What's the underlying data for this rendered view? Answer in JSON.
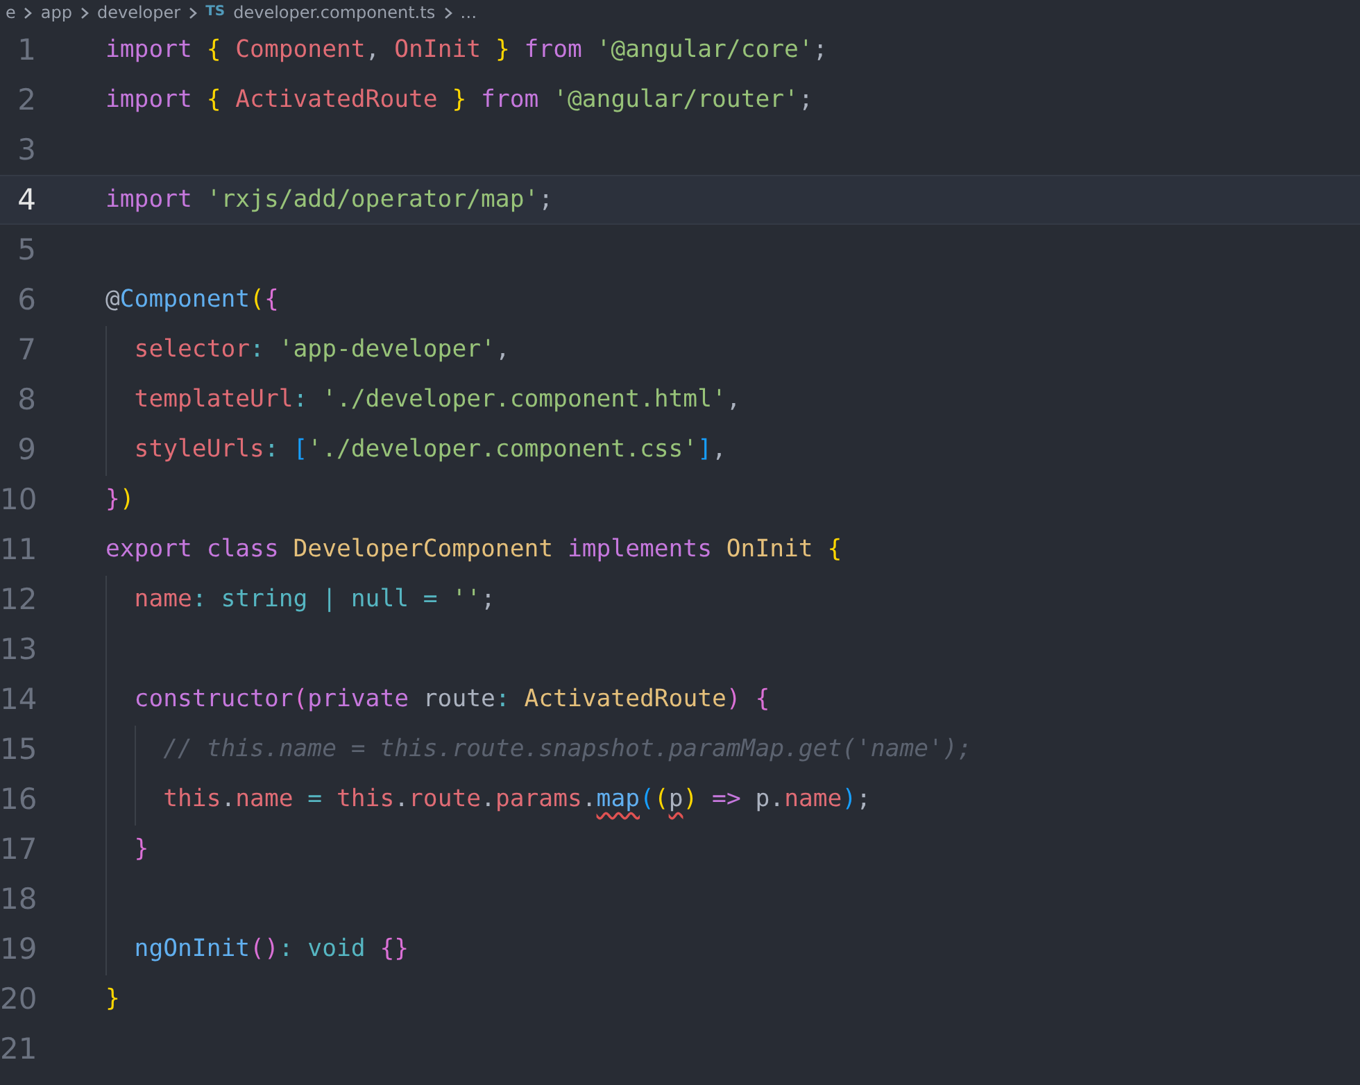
{
  "breadcrumb": {
    "items": [
      {
        "label": "e"
      },
      {
        "label": "app"
      },
      {
        "label": "developer"
      },
      {
        "label": "developer.component.ts",
        "badge": "TS"
      },
      {
        "label": "…"
      }
    ]
  },
  "editor": {
    "lines": [
      {
        "number": "1",
        "current": false,
        "tokens": [
          {
            "kind": "kw",
            "t": "import "
          },
          {
            "kind": "by",
            "t": "{ "
          },
          {
            "kind": "var",
            "t": "Component"
          },
          {
            "kind": "pl",
            "t": ", "
          },
          {
            "kind": "var",
            "t": "OnInit "
          },
          {
            "kind": "by",
            "t": "} "
          },
          {
            "kind": "kw",
            "t": "from "
          },
          {
            "kind": "str",
            "t": "'@angular/core'"
          },
          {
            "kind": "pl",
            "t": ";"
          }
        ]
      },
      {
        "number": "2",
        "current": false,
        "tokens": [
          {
            "kind": "kw",
            "t": "import "
          },
          {
            "kind": "by",
            "t": "{ "
          },
          {
            "kind": "var",
            "t": "ActivatedRoute "
          },
          {
            "kind": "by",
            "t": "} "
          },
          {
            "kind": "kw",
            "t": "from "
          },
          {
            "kind": "str",
            "t": "'@angular/router'"
          },
          {
            "kind": "pl",
            "t": ";"
          }
        ]
      },
      {
        "number": "3",
        "current": false
      },
      {
        "number": "4",
        "current": true,
        "tokens": [
          {
            "kind": "kw",
            "t": "import "
          },
          {
            "kind": "str",
            "t": "'rxjs/add/operator/map'"
          },
          {
            "kind": "pl",
            "t": ";"
          }
        ]
      },
      {
        "number": "5",
        "current": false
      },
      {
        "number": "6",
        "current": false,
        "tokens": [
          {
            "kind": "pl",
            "t": "@"
          },
          {
            "kind": "fn",
            "t": "Component"
          },
          {
            "kind": "by",
            "t": "("
          },
          {
            "kind": "bp",
            "t": "{"
          }
        ]
      },
      {
        "number": "7",
        "current": false,
        "tokens": [
          {
            "kind": "var",
            "t": "  selector"
          },
          {
            "kind": "ty",
            "t": ": "
          },
          {
            "kind": "str",
            "t": "'app-developer'"
          },
          {
            "kind": "pl",
            "t": ","
          }
        ]
      },
      {
        "number": "8",
        "current": false,
        "tokens": [
          {
            "kind": "var",
            "t": "  templateUrl"
          },
          {
            "kind": "ty",
            "t": ": "
          },
          {
            "kind": "str",
            "t": "'./developer.component.html'"
          },
          {
            "kind": "pl",
            "t": ","
          }
        ]
      },
      {
        "number": "9",
        "current": false,
        "tokens": [
          {
            "kind": "var",
            "t": "  styleUrls"
          },
          {
            "kind": "ty",
            "t": ": "
          },
          {
            "kind": "bb",
            "t": "["
          },
          {
            "kind": "str",
            "t": "'./developer.component.css'"
          },
          {
            "kind": "bb",
            "t": "]"
          },
          {
            "kind": "pl",
            "t": ","
          }
        ]
      },
      {
        "number": "10",
        "current": false,
        "tokens": [
          {
            "kind": "bp",
            "t": "}"
          },
          {
            "kind": "by",
            "t": ")"
          }
        ]
      },
      {
        "number": "11",
        "current": false,
        "tokens": [
          {
            "kind": "kw",
            "t": "export class "
          },
          {
            "kind": "cls",
            "t": "DeveloperComponent "
          },
          {
            "kind": "kw",
            "t": "implements "
          },
          {
            "kind": "cls",
            "t": "OnInit "
          },
          {
            "kind": "by",
            "t": "{"
          }
        ]
      },
      {
        "number": "12",
        "current": false,
        "tokens": [
          {
            "kind": "var",
            "t": "  name"
          },
          {
            "kind": "ty",
            "t": ": string | null = "
          },
          {
            "kind": "str",
            "t": "''"
          },
          {
            "kind": "pl",
            "t": ";"
          }
        ]
      },
      {
        "number": "13",
        "current": false
      },
      {
        "number": "14",
        "current": false,
        "tokens": [
          {
            "kind": "kw",
            "t": "  constructor"
          },
          {
            "kind": "bp",
            "t": "("
          },
          {
            "kind": "kw",
            "t": "private "
          },
          {
            "kind": "pl",
            "t": "route"
          },
          {
            "kind": "ty",
            "t": ": "
          },
          {
            "kind": "cls",
            "t": "ActivatedRoute"
          },
          {
            "kind": "bp",
            "t": ") {"
          }
        ]
      },
      {
        "number": "15",
        "current": false,
        "tokens": [
          {
            "kind": "cm",
            "t": "    // this.name = this.route.snapshot.paramMap.get('name');"
          }
        ]
      },
      {
        "number": "16",
        "current": false,
        "tokens": [
          {
            "kind": "var",
            "t": "    this"
          },
          {
            "kind": "pl",
            "t": "."
          },
          {
            "kind": "var",
            "t": "name "
          },
          {
            "kind": "ty",
            "t": "= "
          },
          {
            "kind": "var",
            "t": "this"
          },
          {
            "kind": "pl",
            "t": "."
          },
          {
            "kind": "var",
            "t": "route"
          },
          {
            "kind": "pl",
            "t": "."
          },
          {
            "kind": "var",
            "t": "params"
          },
          {
            "kind": "pl",
            "t": "."
          },
          {
            "kind": "fn",
            "t": "map",
            "error": true
          },
          {
            "kind": "bb",
            "t": "("
          },
          {
            "kind": "by",
            "t": "("
          },
          {
            "kind": "pl",
            "t": "p",
            "error": true
          },
          {
            "kind": "by",
            "t": ") "
          },
          {
            "kind": "kw",
            "t": "=> "
          },
          {
            "kind": "pl",
            "t": "p."
          },
          {
            "kind": "var",
            "t": "name"
          },
          {
            "kind": "bb",
            "t": ")"
          },
          {
            "kind": "pl",
            "t": ";"
          }
        ]
      },
      {
        "number": "17",
        "current": false,
        "tokens": [
          {
            "kind": "bp",
            "t": "  }"
          }
        ]
      },
      {
        "number": "18",
        "current": false
      },
      {
        "number": "19",
        "current": false,
        "tokens": [
          {
            "kind": "fn",
            "t": "  ngOnInit"
          },
          {
            "kind": "bp",
            "t": "()"
          },
          {
            "kind": "ty",
            "t": ": void "
          },
          {
            "kind": "bp",
            "t": "{}"
          }
        ]
      },
      {
        "number": "20",
        "current": false,
        "tokens": [
          {
            "kind": "by",
            "t": "}"
          }
        ]
      },
      {
        "number": "21",
        "current": false
      }
    ]
  }
}
